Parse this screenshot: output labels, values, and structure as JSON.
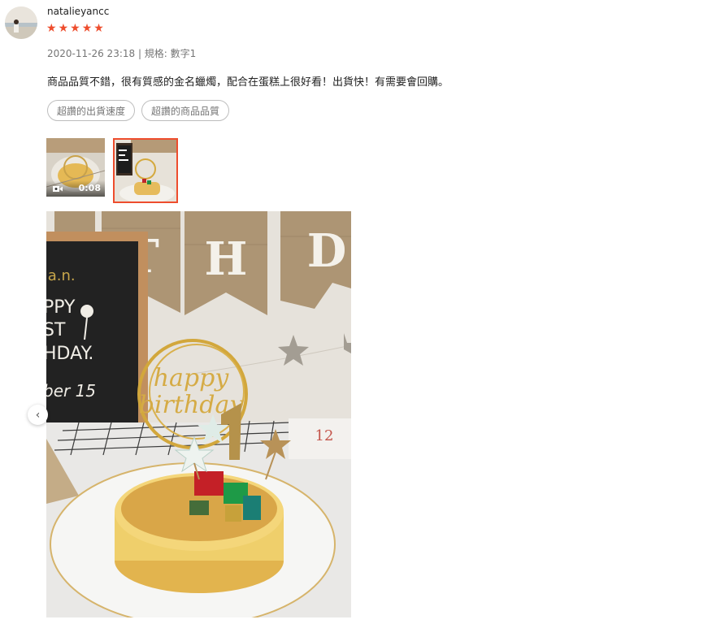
{
  "review": {
    "username": "natalieyancc",
    "rating": 5,
    "datetime_variation": "2020-11-26 23:18 | 規格: 數字1",
    "comment": "商品品質不錯，很有質感的金名蠟燭，配合在蛋糕上很好看！出貨快！有需要會回購。",
    "tags": [
      "超讚的出貨速度",
      "超讚的商品品質"
    ]
  },
  "media": {
    "video_duration": "0:08",
    "selected_index": 1
  },
  "photo_text": {
    "banner_letters": [
      "T",
      "H",
      "D"
    ],
    "board_lines": [
      ".a.n.",
      "PPY",
      "ST",
      "HDAY.",
      "ber 15"
    ],
    "topper": [
      "happy",
      "birthday"
    ],
    "calendar_number": "12"
  },
  "icons": {
    "star": "star-icon",
    "video": "video-camera-icon",
    "prev": "chevron-left-icon"
  },
  "colors": {
    "accent": "#ee4d2d",
    "meta": "#757575"
  }
}
